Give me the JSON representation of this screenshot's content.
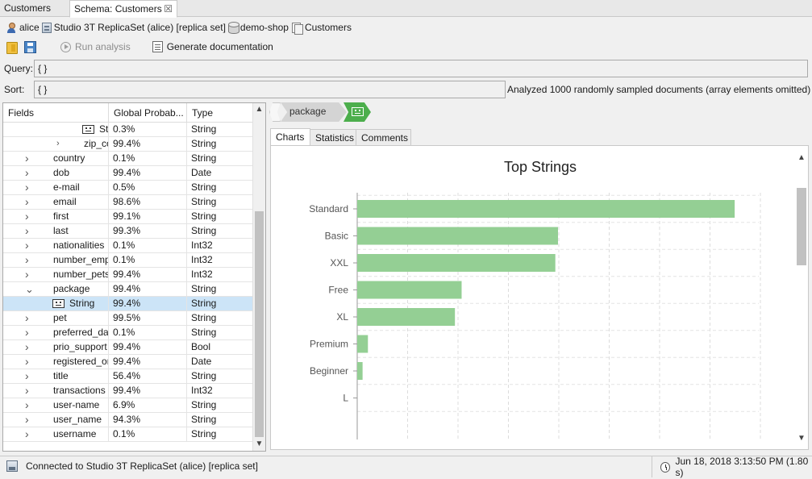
{
  "tabs": [
    {
      "label": "Customers"
    },
    {
      "label": "Schema: Customers",
      "close_icon": "close-icon"
    }
  ],
  "breadcrumbs": {
    "user": "alice",
    "connection": "Studio 3T ReplicaSet (alice) [replica set]",
    "database": "demo-shop",
    "collection": "Customers"
  },
  "toolbar": {
    "run_analysis": "Run analysis",
    "generate_documentation": "Generate documentation"
  },
  "query": {
    "label": "Query:",
    "value": "{ }"
  },
  "sort": {
    "label": "Sort:",
    "value": "{ }"
  },
  "analysis_info": "Analyzed 1000 randomly sampled documents (array elements omitted)",
  "fields_table": {
    "columns": [
      "Fields",
      "Global Probab...",
      "Type"
    ],
    "rows": [
      {
        "name": "St",
        "prob": "0.3%",
        "type": "String",
        "icon": "string-type-icon"
      },
      {
        "name": "zip_co",
        "prob": "99.4%",
        "type": "String",
        "chevron": "right"
      },
      {
        "name": "country",
        "prob": "0.1%",
        "type": "String",
        "chevron": "right"
      },
      {
        "name": "dob",
        "prob": "99.4%",
        "type": "Date",
        "chevron": "right"
      },
      {
        "name": "e-mail",
        "prob": "0.5%",
        "type": "String",
        "chevron": "right"
      },
      {
        "name": "email",
        "prob": "98.6%",
        "type": "String",
        "chevron": "right"
      },
      {
        "name": "first",
        "prob": "99.1%",
        "type": "String",
        "chevron": "right"
      },
      {
        "name": "last",
        "prob": "99.3%",
        "type": "String",
        "chevron": "right"
      },
      {
        "name": "nationalities",
        "prob": "0.1%",
        "type": "Int32",
        "chevron": "right"
      },
      {
        "name": "number_emp",
        "prob": "0.1%",
        "type": "Int32",
        "chevron": "right"
      },
      {
        "name": "number_pets",
        "prob": "99.4%",
        "type": "Int32",
        "chevron": "right"
      },
      {
        "name": "package",
        "prob": "99.4%",
        "type": "String",
        "chevron": "down"
      },
      {
        "name": "String",
        "prob": "99.4%",
        "type": "String",
        "icon": "string-type-icon",
        "selected": true
      },
      {
        "name": "pet",
        "prob": "99.5%",
        "type": "String",
        "chevron": "right"
      },
      {
        "name": "preferred_dat",
        "prob": "0.1%",
        "type": "String",
        "chevron": "right"
      },
      {
        "name": "prio_support",
        "prob": "99.4%",
        "type": "Bool",
        "chevron": "right"
      },
      {
        "name": "registered_or",
        "prob": "99.4%",
        "type": "Date",
        "chevron": "right"
      },
      {
        "name": "title",
        "prob": "56.4%",
        "type": "String",
        "chevron": "right"
      },
      {
        "name": "transactions",
        "prob": "99.4%",
        "type": "Int32",
        "chevron": "right"
      },
      {
        "name": "user-name",
        "prob": "6.9%",
        "type": "String",
        "chevron": "right"
      },
      {
        "name": "user_name",
        "prob": "94.3%",
        "type": "String",
        "chevron": "right"
      },
      {
        "name": "username",
        "prob": "0.1%",
        "type": "String",
        "chevron": "right"
      }
    ]
  },
  "path_breadcrumb": {
    "segment": "package",
    "current_icon": "string-type-icon"
  },
  "detail_tabs": [
    {
      "label": "Charts",
      "active": true
    },
    {
      "label": "Statistics"
    },
    {
      "label": "Comments"
    }
  ],
  "chart_data": {
    "type": "bar",
    "orientation": "horizontal",
    "title": "Top Strings",
    "categories": [
      "Standard",
      "Basic",
      "XXL",
      "Free",
      "XL",
      "Premium",
      "Beginner",
      "L"
    ],
    "values": [
      282,
      150,
      148,
      78,
      73,
      8,
      4,
      0
    ],
    "xlim": [
      0,
      300
    ],
    "grid": true,
    "bar_color": "#94cf94"
  },
  "status": {
    "connection": "Connected to Studio 3T ReplicaSet (alice) [replica set]",
    "timestamp": "Jun 18, 2018 3:13:50 PM (1.80 s)"
  },
  "colors": {
    "accent_green": "#4cae4c",
    "selection": "#cce4f7"
  }
}
